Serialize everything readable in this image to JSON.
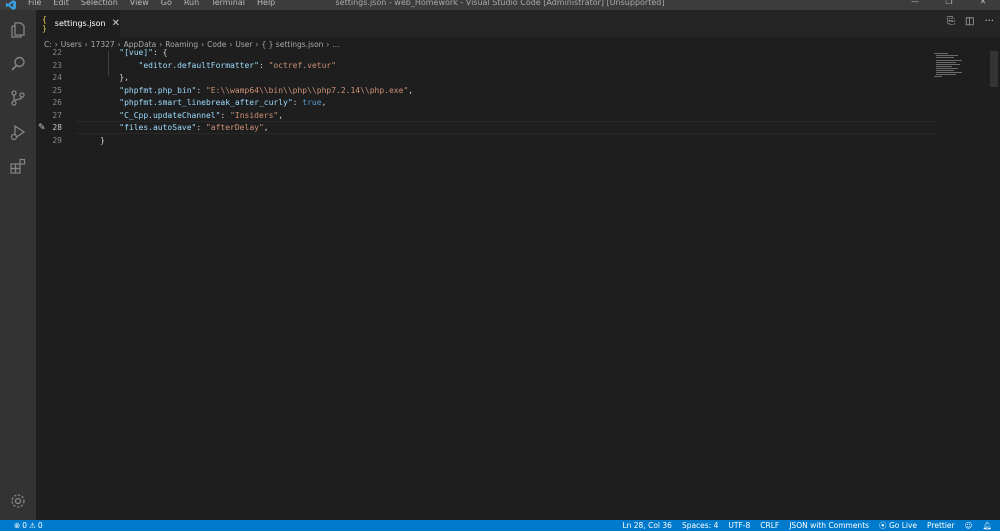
{
  "window": {
    "title": "settings.json - web_Homework - Visual Studio Code [Administrator] [Unsupported]",
    "menu": [
      "File",
      "Edit",
      "Selection",
      "View",
      "Go",
      "Run",
      "Terminal",
      "Help"
    ],
    "controls": {
      "minimize": "—",
      "restore": "❐",
      "close": "✕"
    }
  },
  "tab": {
    "icon": "{ }",
    "label": "settings.json",
    "close": "✕"
  },
  "breadcrumb": [
    "C:",
    "Users",
    "17327",
    "AppData",
    "Roaming",
    "Code",
    "User",
    "{ } settings.json",
    "..."
  ],
  "editor": {
    "lines": [
      {
        "num": "22",
        "parts": [
          {
            "c": "p",
            "t": "    "
          },
          {
            "c": "k",
            "t": "\"[vue]\""
          },
          {
            "c": "p",
            "t": ": {"
          }
        ]
      },
      {
        "num": "23",
        "parts": [
          {
            "c": "p",
            "t": "        "
          },
          {
            "c": "k",
            "t": "\"editor.defaultFormatter\""
          },
          {
            "c": "p",
            "t": ": "
          },
          {
            "c": "s",
            "t": "\"octref.vetur\""
          }
        ]
      },
      {
        "num": "24",
        "parts": [
          {
            "c": "p",
            "t": "    },"
          }
        ]
      },
      {
        "num": "25",
        "parts": [
          {
            "c": "p",
            "t": "    "
          },
          {
            "c": "k",
            "t": "\"phpfmt.php_bin\""
          },
          {
            "c": "p",
            "t": ": "
          },
          {
            "c": "s",
            "t": "\"E:\\\\wamp64\\\\bin\\\\php\\\\php7.2.14\\\\php.exe\""
          },
          {
            "c": "p",
            "t": ","
          }
        ]
      },
      {
        "num": "26",
        "parts": [
          {
            "c": "p",
            "t": "    "
          },
          {
            "c": "k",
            "t": "\"phpfmt.smart_linebreak_after_curly\""
          },
          {
            "c": "p",
            "t": ": "
          },
          {
            "c": "b",
            "t": "true"
          },
          {
            "c": "p",
            "t": ","
          }
        ]
      },
      {
        "num": "27",
        "parts": [
          {
            "c": "p",
            "t": "    "
          },
          {
            "c": "k",
            "t": "\"C_Cpp.updateChannel\""
          },
          {
            "c": "p",
            "t": ": "
          },
          {
            "c": "s",
            "t": "\"Insiders\""
          },
          {
            "c": "p",
            "t": ","
          }
        ]
      },
      {
        "num": "28",
        "parts": [
          {
            "c": "p",
            "t": "    "
          },
          {
            "c": "k",
            "t": "\"files.autoSave\""
          },
          {
            "c": "p",
            "t": ": "
          },
          {
            "c": "s",
            "t": "\"afterDelay\""
          },
          {
            "c": "p",
            "t": ","
          }
        ]
      },
      {
        "num": "29",
        "parts": [
          {
            "c": "p",
            "t": "}"
          }
        ]
      }
    ]
  },
  "statusbar": {
    "errors": "0",
    "warnings": "0",
    "position": "Ln 28, Col 36",
    "spaces": "Spaces: 4",
    "encoding": "UTF-8",
    "eol": "CRLF",
    "language": "JSON with Comments",
    "golive": "Go Live",
    "prettier": "Prettier"
  },
  "colors": {
    "accent": "#007acc",
    "key": "#9cdcfe",
    "string": "#ce9178",
    "boolean": "#569cd6"
  }
}
